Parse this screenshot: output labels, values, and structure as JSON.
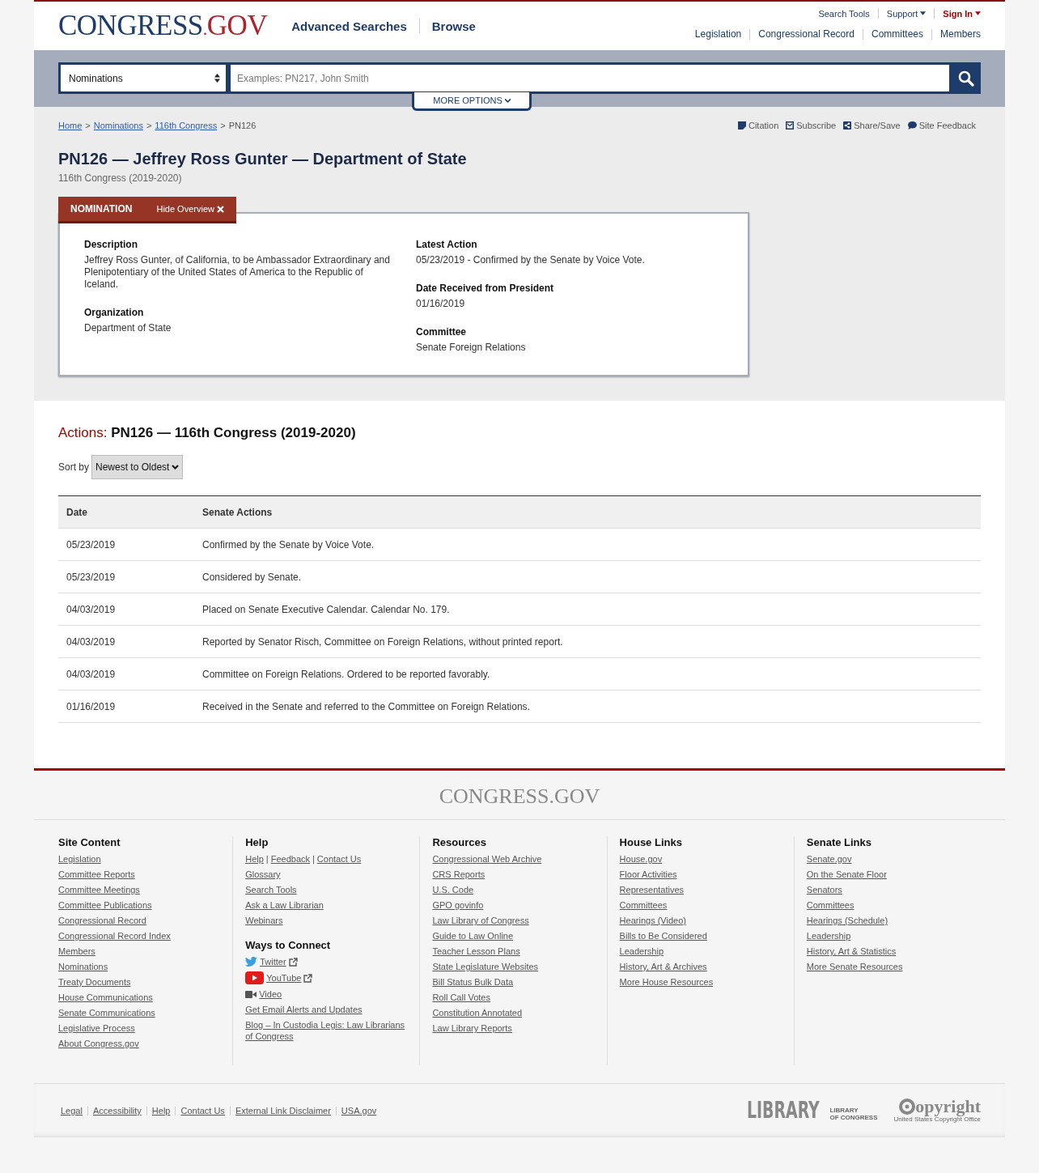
{
  "header": {
    "logo": {
      "left": "CONGRESS",
      "dot": ".",
      "right": "GOV"
    },
    "main_nav": [
      "Advanced Searches",
      "Browse"
    ],
    "utility_links": [
      {
        "label": "Search Tools",
        "kind": "plain"
      },
      {
        "label": "Support",
        "kind": "menu"
      },
      {
        "label": "Sign In",
        "kind": "account"
      }
    ],
    "secondary_nav": [
      "Legislation",
      "Congressional Record",
      "Committees",
      "Members"
    ]
  },
  "search": {
    "scope": "Nominations",
    "placeholder": "Examples: PN217, John Smith",
    "more_options": "MORE OPTIONS"
  },
  "breadcrumb_separator": ">",
  "breadcrumbs": [
    {
      "label": "Home",
      "link": true
    },
    {
      "label": "Nominations",
      "link": true
    },
    {
      "label": "116th Congress",
      "link": true
    },
    {
      "label": "PN126",
      "link": false
    }
  ],
  "page_tools": [
    {
      "label": "Citation",
      "kind": "citation"
    },
    {
      "label": "Subscribe",
      "kind": "subscribe"
    },
    {
      "label": "Share/Save",
      "kind": "share"
    },
    {
      "label": "Site Feedback",
      "kind": "feedback"
    }
  ],
  "title": "PN126 — Jeffrey Ross Gunter — Department of State",
  "subtitle": "116th Congress (2019-2020)",
  "overview": {
    "tab": "NOMINATION",
    "toggle": "Hide Overview",
    "left": [
      {
        "label": "Description",
        "value": "Jeffrey Ross Gunter, of California, to be Ambassador Extraordinary and Plenipotentiary of the United States of America to the Republic of Iceland."
      },
      {
        "label": "Organization",
        "value": "Department of State"
      }
    ],
    "right": [
      {
        "label": "Latest Action",
        "value": "05/23/2019 - Confirmed by the Senate by Voice Vote."
      },
      {
        "label": "Date Received from President",
        "value": "01/16/2019"
      },
      {
        "label": "Committee",
        "value": "Senate Foreign Relations"
      }
    ]
  },
  "actions": {
    "heading_label": "Actions:",
    "heading": "PN126 — 116th Congress (2019-2020)",
    "sort_label": "Sort by",
    "sort_value": "Newest to Oldest",
    "columns": [
      "Date",
      "Senate Actions"
    ],
    "rows": [
      [
        "05/23/2019",
        "Confirmed by the Senate by Voice Vote."
      ],
      [
        "05/23/2019",
        "Considered by Senate."
      ],
      [
        "04/03/2019",
        "Placed on Senate Executive Calendar. Calendar No. 179."
      ],
      [
        "04/03/2019",
        "Reported by Senator Risch, Committee on Foreign Relations, without printed report."
      ],
      [
        "04/03/2019",
        "Committee on Foreign Relations. Ordered to be reported favorably."
      ],
      [
        "01/16/2019",
        "Received in the Senate and referred to the Committee on Foreign Relations."
      ]
    ]
  },
  "footer": {
    "logo": "CONGRESS.GOV",
    "link_separator": "|",
    "columns": [
      {
        "sections": [
          {
            "title": "Site Content",
            "items": [
              {
                "links": [
                  "Legislation"
                ]
              },
              {
                "links": [
                  "Committee Reports"
                ]
              },
              {
                "links": [
                  "Committee Meetings"
                ]
              },
              {
                "links": [
                  "Committee Publications"
                ]
              },
              {
                "links": [
                  "Congressional Record"
                ]
              },
              {
                "links": [
                  "Congressional Record Index"
                ]
              },
              {
                "links": [
                  "Members"
                ]
              },
              {
                "links": [
                  "Nominations"
                ]
              },
              {
                "links": [
                  "Treaty Documents"
                ]
              },
              {
                "links": [
                  "House Communications"
                ]
              },
              {
                "links": [
                  "Senate Communications"
                ]
              },
              {
                "links": [
                  "Legislative Process"
                ]
              },
              {
                "links": [
                  "About Congress.gov"
                ]
              }
            ]
          }
        ]
      },
      {
        "sections": [
          {
            "title": "Help",
            "items": [
              {
                "links": [
                  "Help",
                  "Feedback",
                  "Contact Us"
                ]
              },
              {
                "links": [
                  "Glossary"
                ]
              },
              {
                "links": [
                  "Search Tools"
                ]
              },
              {
                "links": [
                  "Ask a Law Librarian"
                ]
              },
              {
                "links": [
                  "Webinars"
                ]
              }
            ]
          },
          {
            "title": "Ways to Connect",
            "items": [
              {
                "links": [
                  "Twitter"
                ],
                "kind": "twitter",
                "external": true
              },
              {
                "links": [
                  "YouTube"
                ],
                "kind": "youtube",
                "external": true
              },
              {
                "links": [
                  "Video"
                ],
                "kind": "video",
                "external": false
              },
              {
                "links": [
                  "Get Email Alerts and Updates"
                ]
              },
              {
                "links": [
                  "Blog – In Custodia Legis: Law Librarians of Congress"
                ]
              }
            ]
          }
        ]
      },
      {
        "sections": [
          {
            "title": "Resources",
            "items": [
              {
                "links": [
                  "Congressional Web Archive"
                ]
              },
              {
                "links": [
                  "CRS Reports"
                ]
              },
              {
                "links": [
                  "U.S. Code"
                ]
              },
              {
                "links": [
                  "GPO govinfo"
                ]
              },
              {
                "links": [
                  "Law Library of Congress"
                ]
              },
              {
                "links": [
                  "Guide to Law Online"
                ]
              },
              {
                "links": [
                  "Teacher Lesson Plans"
                ]
              },
              {
                "links": [
                  "State Legislature Websites"
                ]
              },
              {
                "links": [
                  "Bill Status Bulk Data"
                ]
              },
              {
                "links": [
                  "Roll Call Votes"
                ]
              },
              {
                "links": [
                  "Constitution Annotated"
                ]
              },
              {
                "links": [
                  "Law Library Reports"
                ]
              }
            ]
          }
        ]
      },
      {
        "sections": [
          {
            "title": "House Links",
            "items": [
              {
                "links": [
                  "House.gov"
                ]
              },
              {
                "links": [
                  "Floor Activities"
                ]
              },
              {
                "links": [
                  "Representatives"
                ]
              },
              {
                "links": [
                  "Committees"
                ]
              },
              {
                "links": [
                  "Hearings (Video)"
                ]
              },
              {
                "links": [
                  "Bills to Be Considered"
                ]
              },
              {
                "links": [
                  "Leadership"
                ]
              },
              {
                "links": [
                  "History, Art & Archives"
                ]
              },
              {
                "links": [
                  "More House Resources"
                ]
              }
            ]
          }
        ]
      },
      {
        "sections": [
          {
            "title": "Senate Links",
            "items": [
              {
                "links": [
                  "Senate.gov"
                ]
              },
              {
                "links": [
                  "On the Senate Floor"
                ]
              },
              {
                "links": [
                  "Senators"
                ]
              },
              {
                "links": [
                  "Committees"
                ]
              },
              {
                "links": [
                  "Hearings (Schedule)"
                ]
              },
              {
                "links": [
                  "Leadership"
                ]
              },
              {
                "links": [
                  "History, Art & Statistics"
                ]
              },
              {
                "links": [
                  "More Senate Resources"
                ]
              }
            ]
          }
        ]
      }
    ],
    "bottom_links": [
      "Legal",
      "Accessibility",
      "Help",
      "Contact Us",
      "External Link Disclaimer",
      "USA.gov"
    ],
    "agency_logos": [
      {
        "kind": "library",
        "main": "LIBRARY",
        "sub": [
          "LIBRARY",
          "OF CONGRESS"
        ]
      },
      {
        "kind": "copyright",
        "main": "opyright",
        "sub": [
          "United States Copyright Office"
        ]
      }
    ]
  }
}
